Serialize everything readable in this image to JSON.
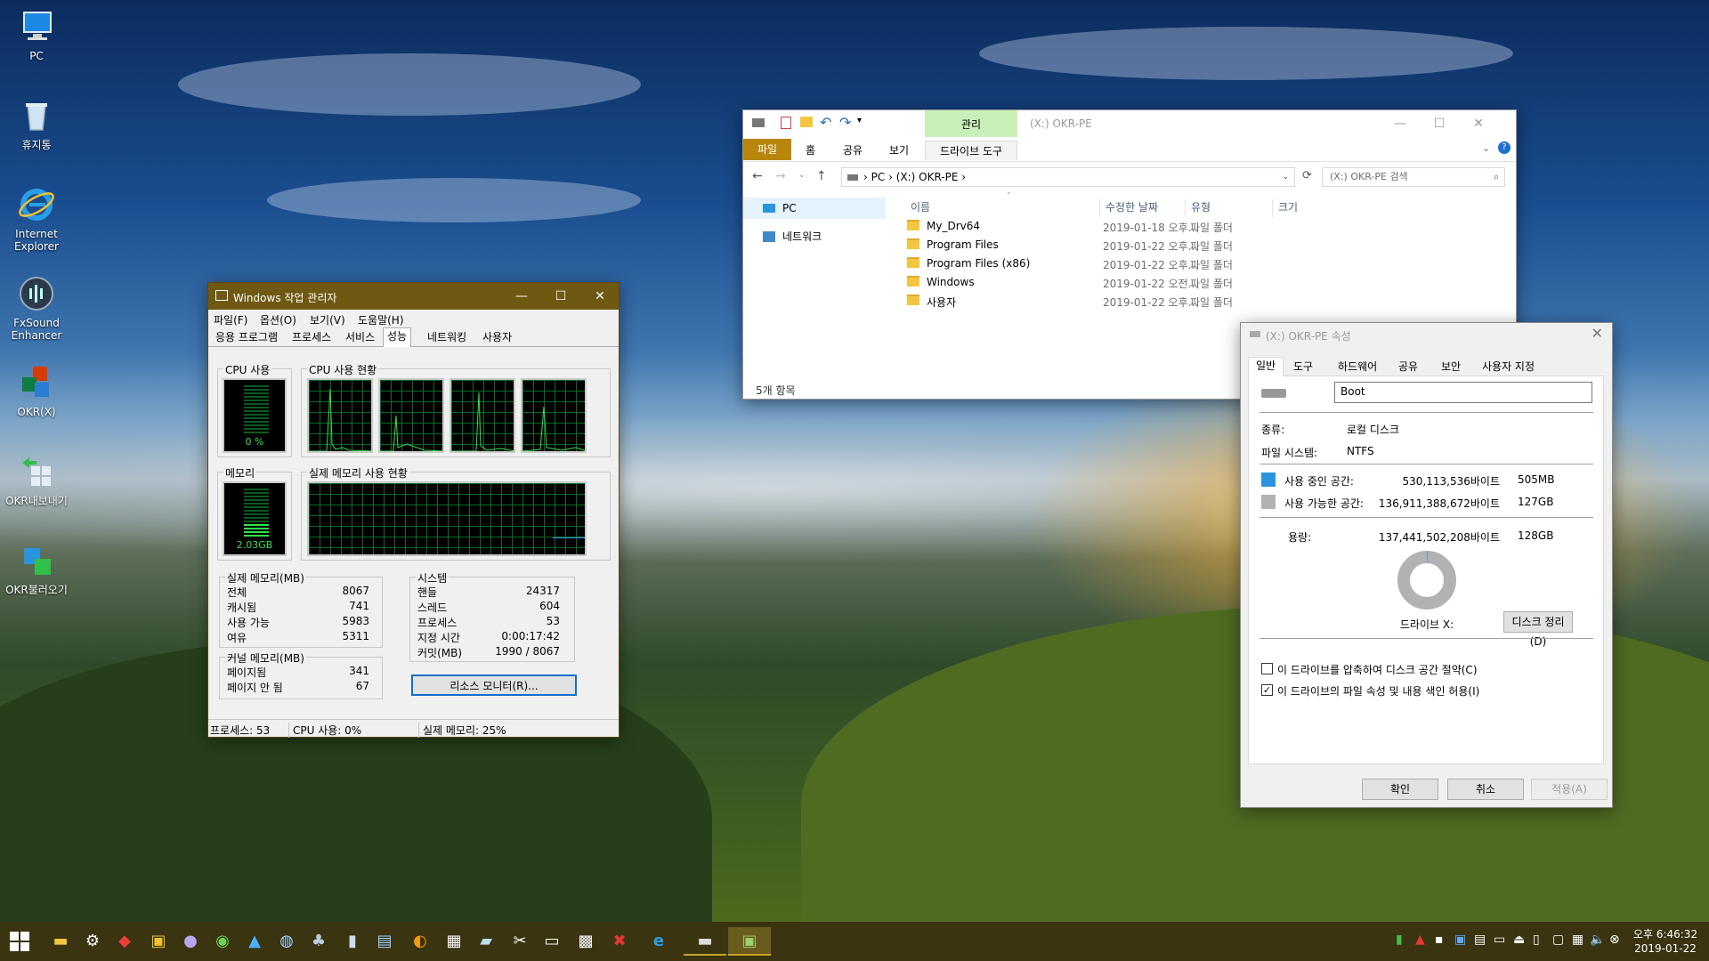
{
  "desktop": {
    "icons": [
      {
        "label": "PC",
        "icon": "computer-icon"
      },
      {
        "label": "휴지통",
        "icon": "recycle-bin-icon"
      },
      {
        "label": "Internet Explorer",
        "icon": "internet-explorer-icon"
      },
      {
        "label": "FxSound Enhancer",
        "icon": "fxsound-icon"
      },
      {
        "label": "OKR(X)",
        "icon": "office-icon"
      },
      {
        "label": "OKR내보내기",
        "icon": "export-icon"
      },
      {
        "label": "OKR불러오기",
        "icon": "import-icon"
      }
    ]
  },
  "explorer": {
    "context_tab": "관리",
    "title": "(X:) OKR-PE",
    "ribbon_tabs": [
      "파일",
      "홈",
      "공유",
      "보기",
      "드라이브 도구"
    ],
    "breadcrumb": [
      "PC",
      "(X:) OKR-PE"
    ],
    "search_placeholder": "(X:) OKR-PE 검색",
    "nav": [
      "PC",
      "네트워크"
    ],
    "columns": [
      "이름",
      "수정한 날짜",
      "유형",
      "크기"
    ],
    "files": [
      {
        "name": "My_Drv64",
        "date": "2019-01-18 오후...",
        "type": "파일 폴더"
      },
      {
        "name": "Program Files",
        "date": "2019-01-22 오후...",
        "type": "파일 폴더"
      },
      {
        "name": "Program Files (x86)",
        "date": "2019-01-22 오후...",
        "type": "파일 폴더"
      },
      {
        "name": "Windows",
        "date": "2019-01-22 오전...",
        "type": "파일 폴더"
      },
      {
        "name": "사용자",
        "date": "2019-01-22 오후...",
        "type": "파일 폴더"
      }
    ],
    "status": "5개 항목"
  },
  "taskmgr": {
    "title": "Windows 작업 관리자",
    "menu": [
      "파일(F)",
      "옵션(O)",
      "보기(V)",
      "도움말(H)"
    ],
    "tabs": [
      "응용 프로그램",
      "프로세스",
      "서비스",
      "성능",
      "네트워킹",
      "사용자"
    ],
    "active_tab": "성능",
    "cpu_usage_label": "CPU 사용",
    "cpu_usage_value": "0 %",
    "cpu_history_label": "CPU 사용 현황",
    "memory_label": "메모리",
    "memory_value": "2.03GB",
    "memory_history_label": "실제 메모리 사용 현황",
    "physical": {
      "title": "실제 메모리(MB)",
      "rows": [
        [
          "전체",
          "8067"
        ],
        [
          "캐시됨",
          "741"
        ],
        [
          "사용 가능",
          "5983"
        ],
        [
          "여유",
          "5311"
        ]
      ]
    },
    "kernel": {
      "title": "커널 메모리(MB)",
      "rows": [
        [
          "페이지됨",
          "341"
        ],
        [
          "페이지 안 됨",
          "67"
        ]
      ]
    },
    "system": {
      "title": "시스템",
      "rows": [
        [
          "핸들",
          "24317"
        ],
        [
          "스레드",
          "604"
        ],
        [
          "프로세스",
          "53"
        ],
        [
          "지정 시간",
          "0:00:17:42"
        ],
        [
          "커밋(MB)",
          "1990 / 8067"
        ]
      ]
    },
    "resource_button": "리소스 모니터(R)...",
    "status": {
      "processes": "프로세스: 53",
      "cpu": "CPU 사용: 0%",
      "memory": "실제 메모리: 25%"
    },
    "cpu_level": 0,
    "memory_level": 0.25
  },
  "props": {
    "title": "(X:) OKR-PE 속성",
    "tabs": [
      "일반",
      "도구",
      "하드웨어",
      "공유",
      "보안",
      "사용자 지정"
    ],
    "name_value": "Boot",
    "type_label": "종류:",
    "type_value": "로컬 디스크",
    "fs_label": "파일 시스템:",
    "fs_value": "NTFS",
    "used_label": "사용 중인 공간:",
    "used_bytes": "530,113,536바이트",
    "used_size": "505MB",
    "free_label": "사용 가능한 공간:",
    "free_bytes": "136,911,388,672바이트",
    "free_size": "127GB",
    "cap_label": "용량:",
    "cap_bytes": "137,441,502,208바이트",
    "cap_size": "128GB",
    "drive_label": "드라이브 X:",
    "cleanup_button": "디스크 정리(D)",
    "compress_label": "이 드라이브를 압축하여 디스크 공간 절약(C)",
    "index_label": "이 드라이브의 파일 속성 및 내용 색인 허용(I)",
    "ok": "확인",
    "cancel": "취소",
    "apply": "적용(A)",
    "used_color": "#2a95dd",
    "free_color": "#b2b2b2"
  },
  "taskbar": {
    "time": "오후 6:46:32",
    "date": "2019-01-22"
  }
}
